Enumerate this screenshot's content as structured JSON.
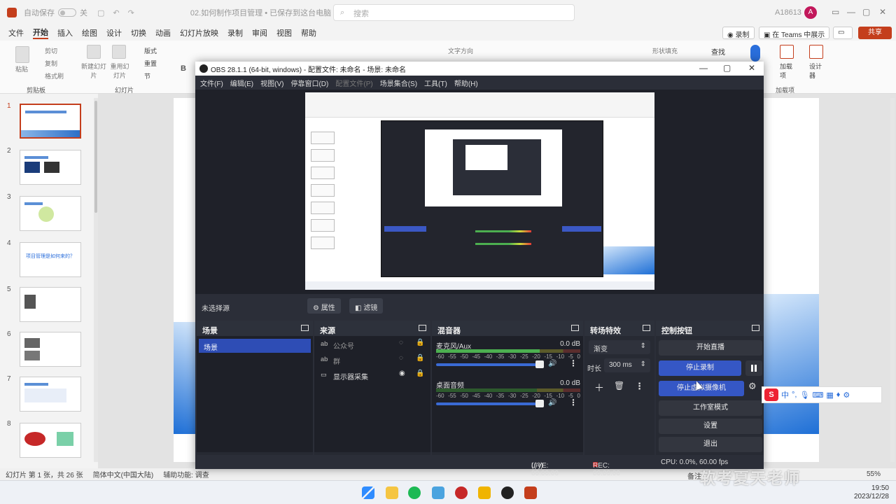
{
  "ppt": {
    "autosave_label": "自动保存",
    "autosave_state": "关",
    "doc_title": "02.如何制作项目管理 • 已保存到这台电脑",
    "search_placeholder": "搜索",
    "user_name": "A18613",
    "user_initial": "A",
    "menu": [
      "文件",
      "开始",
      "插入",
      "绘图",
      "设计",
      "切换",
      "动画",
      "幻灯片放映",
      "录制",
      "审阅",
      "视图",
      "帮助"
    ],
    "active_menu": "开始",
    "record_btn": "录制",
    "teams_btn": "在 Teams 中展示",
    "share_btn": "共享",
    "ribbon": {
      "paste": "粘贴",
      "cut": "剪切",
      "copy": "复制",
      "format_painter": "格式刷",
      "new_slide": "新建幻灯片",
      "reuse_slide": "重用幻灯片",
      "layout": "版式",
      "reset": "重置",
      "section": "节",
      "clipboard_group": "剪贴板",
      "slides_group": "幻灯片",
      "text_direction": "文字方向",
      "shape_fill": "形状填充",
      "find": "查找",
      "addins": "加载项",
      "addins_group": "加载项",
      "designer": "设计器",
      "bold": "B"
    },
    "thumbnail_numbers": [
      "1",
      "2",
      "3",
      "4",
      "5",
      "6",
      "7",
      "8"
    ],
    "thumbnail_4_title": "项目管理是如何来的？",
    "status_slide": "幻灯片 第 1 张，共 26 张",
    "status_lang": "简体中文(中国大陆)",
    "status_access": "辅助功能: 调查",
    "notes": "备注",
    "zoom": "55%"
  },
  "obs": {
    "title": "OBS 28.1.1 (64-bit, windows) - 配置文件: 未命名 - 场景: 未命名",
    "menu": [
      "文件(F)",
      "编辑(E)",
      "视图(V)",
      "停靠窗口(D)",
      "配置文件(P)",
      "场景集合(S)",
      "工具(T)",
      "帮助(H)"
    ],
    "no_source": "未选择源",
    "properties_btn": "属性",
    "filters_btn": "滤镜",
    "docks": {
      "scenes": "场景",
      "sources": "来源",
      "mixer": "混音器",
      "transitions": "转场特效",
      "controls": "控制按钮"
    },
    "scene_items": [
      "场景"
    ],
    "sources": [
      {
        "type": "ab",
        "name": "公众号"
      },
      {
        "type": "ab",
        "name": "群"
      },
      {
        "type": "▭",
        "name": "显示器采集"
      }
    ],
    "mixer": [
      {
        "name": "麦克风/Aux",
        "db": "0.0 dB",
        "level": 0.72
      },
      {
        "name": "桌面音频",
        "db": "0.0 dB",
        "level": 0.0
      }
    ],
    "meter_ticks": [
      "-60",
      "-55",
      "-50",
      "-45",
      "-40",
      "-35",
      "-30",
      "-25",
      "-20",
      "-15",
      "-10",
      "-5",
      "0"
    ],
    "transition": {
      "type": "渐变",
      "duration_label": "时长",
      "duration": "300 ms"
    },
    "controls": {
      "start_stream": "开始直播",
      "stop_record": "停止录制",
      "stop_virtualcam": "停止虚拟摄像机",
      "studio_mode": "工作室模式",
      "settings": "设置",
      "exit": "退出"
    },
    "status": {
      "live": "LIVE: 00:00:00",
      "rec": "REC: 00:00:00",
      "cpu": "CPU: 0.0%, 60.00 fps"
    }
  },
  "taskbar": {
    "time": "19:50",
    "date": "2023/12/28"
  },
  "watermark": "软考夏天老师",
  "ime": {
    "logo": "S",
    "mode": "中"
  },
  "colors": {
    "ppt_accent": "#c43e1c",
    "obs_bg": "#2b2e38",
    "obs_blue": "#3557c5",
    "meter_green": "#4caf50"
  }
}
